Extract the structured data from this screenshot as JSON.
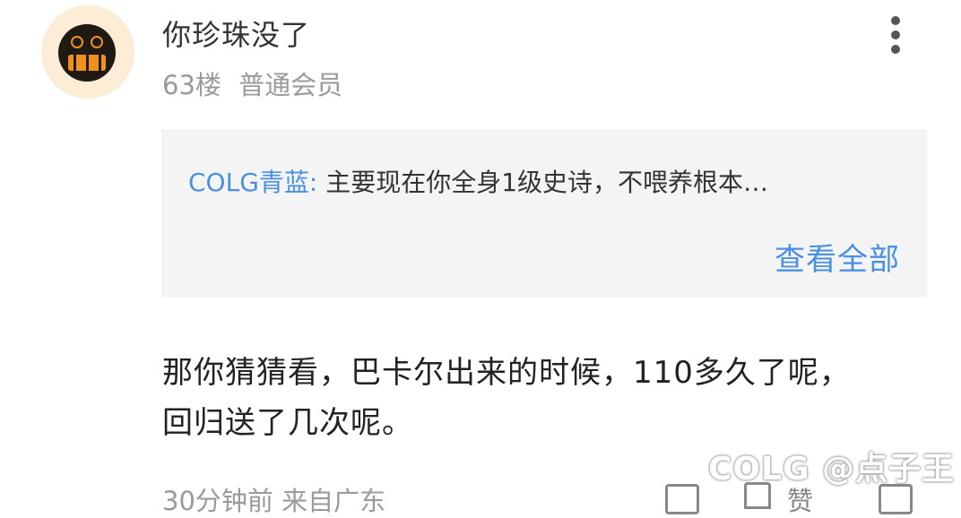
{
  "post": {
    "username": "你珍珠没了",
    "floor": "63楼",
    "member_level": "普通会员",
    "quote": {
      "author": "COLG青蓝:",
      "text": " 主要现在你全身1级史诗，不喂养根本…",
      "view_all_label": "查看全部"
    },
    "content": "那你猜猜看，巴卡尔出来的时候，110多久了呢，回归送了几次呢。",
    "time_source": "30分钟前 来自广东",
    "like_label": "赞"
  },
  "watermark": "COLG @点子王",
  "icons": {
    "avatar": "avatar-face-icon",
    "more": "more-vertical-icon",
    "comment": "comment-icon",
    "like": "thumbs-up-icon",
    "share": "share-icon"
  },
  "colors": {
    "link_blue": "#4a90e2",
    "quote_bg": "#f4f4f4",
    "avatar_bg": "#fdecd6",
    "avatar_accent": "#f0901e"
  }
}
